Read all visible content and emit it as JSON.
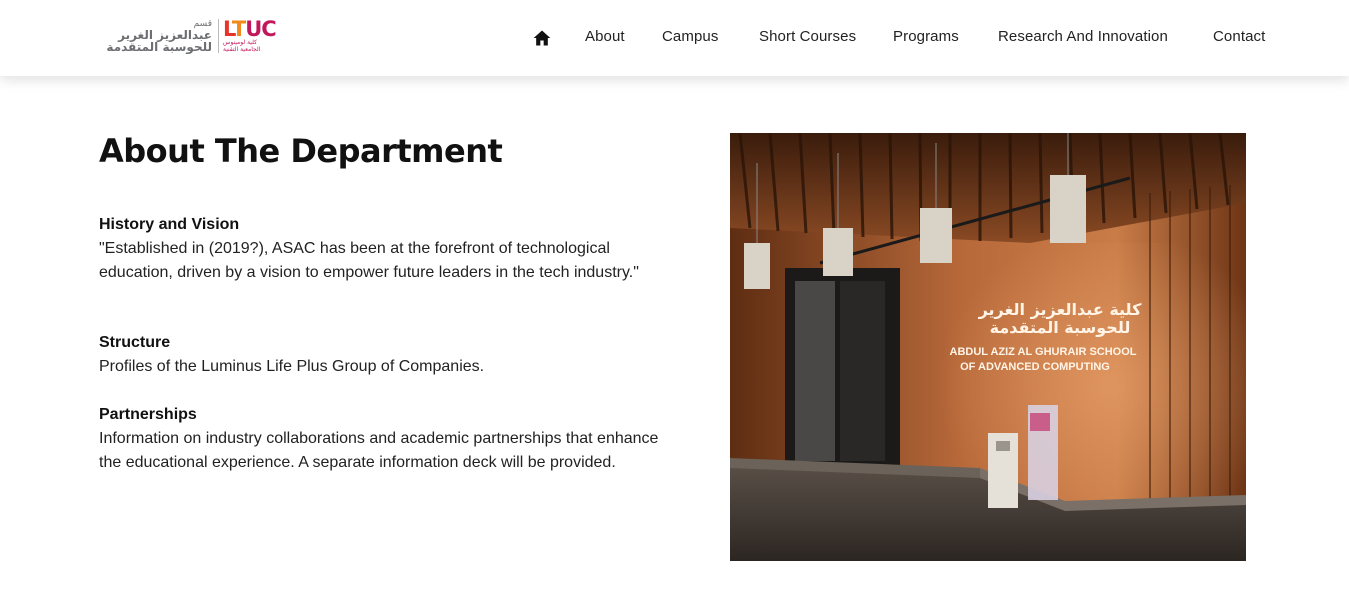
{
  "logo": {
    "arabic_line1": "قسم",
    "arabic_line2": "عبدالعزيز الغرير",
    "arabic_line3": "للحوسبة المتقدمة",
    "brand_letters": [
      "L",
      "T",
      "U",
      "C"
    ],
    "brand_sub_line1": "كلية لومينوس",
    "brand_sub_line2": "الجامعية التقنية"
  },
  "nav": {
    "home_icon": "home-icon",
    "items": [
      "About",
      "Campus",
      "Short Courses",
      "Programs",
      "Research And Innovation",
      "Contact"
    ]
  },
  "main": {
    "title": "About The Department",
    "sections": [
      {
        "heading": "History and Vision",
        "body": "\"Established in (2019?), ASAC has been at the forefront of technological education, driven by a vision to empower future leaders in the tech industry.\""
      },
      {
        "heading": "Structure",
        "body": "Profiles of the Luminus Life Plus Group of Companies."
      },
      {
        "heading": "Partnerships",
        "body": "Information on industry collaborations and academic partnerships that enhance the educational experience. A separate information deck will be provided."
      }
    ]
  },
  "photo": {
    "sign_arabic_line1": "كلية عبدالعزيز الغرير",
    "sign_arabic_line2": "للحوسبة المتقدمة",
    "sign_english_line1": "ABDUL AZIZ AL GHURAIR SCHOOL",
    "sign_english_line2": "OF ADVANCED COMPUTING"
  },
  "colors": {
    "brand_red": "#e8332a",
    "brand_orange": "#f08a1c",
    "brand_magenta": "#c2185b",
    "wood": "#a25a2c"
  }
}
